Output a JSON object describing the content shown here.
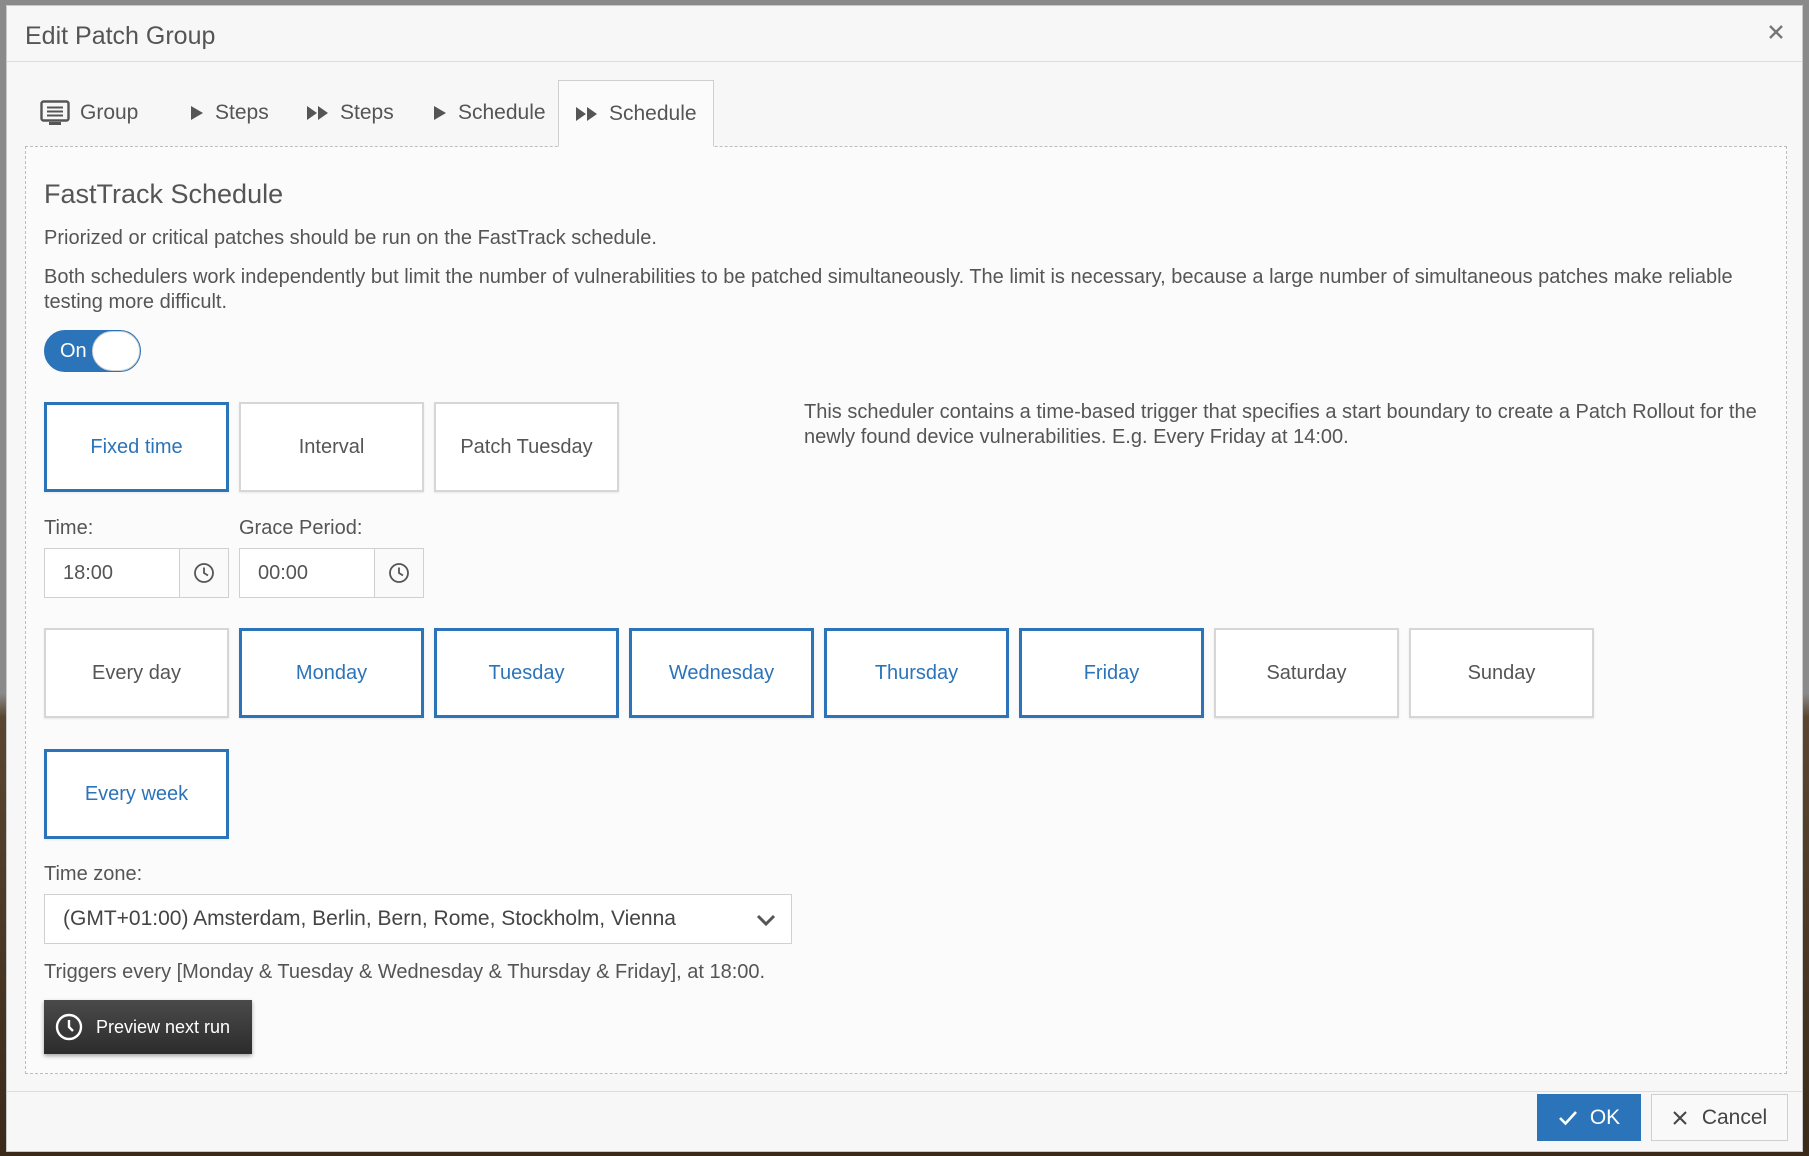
{
  "dialog": {
    "title": "Edit Patch Group"
  },
  "tabs": [
    {
      "label": "Group",
      "icon": "monitor-icon"
    },
    {
      "label": "Steps",
      "icon": "play-icon"
    },
    {
      "label": "Steps",
      "icon": "fast-forward-icon"
    },
    {
      "label": "Schedule",
      "icon": "play-icon"
    },
    {
      "label": "Schedule",
      "icon": "fast-forward-icon",
      "active": true
    }
  ],
  "section": {
    "heading": "FastTrack Schedule",
    "intro": "Priorized or critical patches should be run on the FastTrack schedule.",
    "note": "Both schedulers work independently but limit the number of vulnerabilities to be patched simultaneously. The limit is necessary, because a large number of simultaneous patches make reliable testing more difficult."
  },
  "toggle": {
    "label": "On",
    "state": "on"
  },
  "trigger_types": {
    "selected": "Fixed time",
    "options": [
      "Fixed time",
      "Interval",
      "Patch Tuesday"
    ]
  },
  "trigger_description": "This scheduler contains a time-based trigger that specifies a start boundary to create a Patch Rollout for the newly found device vulnerabilities. E.g. Every Friday at 14:00.",
  "time": {
    "label": "Time:",
    "value": "18:00"
  },
  "grace_period": {
    "label": "Grace Period:",
    "value": "00:00"
  },
  "days": {
    "options": [
      "Every day",
      "Monday",
      "Tuesday",
      "Wednesday",
      "Thursday",
      "Friday",
      "Saturday",
      "Sunday"
    ],
    "selected": [
      "Monday",
      "Tuesday",
      "Wednesday",
      "Thursday",
      "Friday"
    ]
  },
  "frequency": {
    "label": "Every week",
    "selected": true
  },
  "timezone": {
    "label": "Time zone:",
    "value": "(GMT+01:00) Amsterdam, Berlin, Bern, Rome, Stockholm, Vienna"
  },
  "summary": "Triggers every [Monday & Tuesday & Wednesday & Thursday & Friday], at 18:00.",
  "buttons": {
    "preview": "Preview next run",
    "ok": "OK",
    "cancel": "Cancel"
  },
  "colors": {
    "accent": "#2b74b9",
    "dark_button": "#333333"
  }
}
